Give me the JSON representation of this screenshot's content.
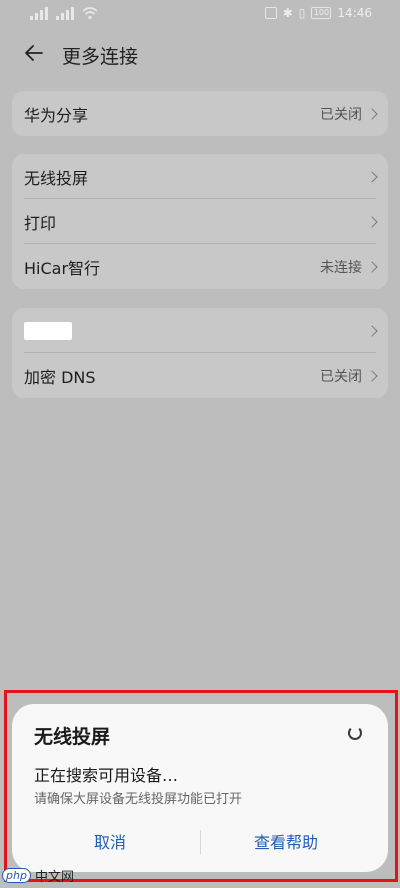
{
  "status_bar": {
    "time": "14:46",
    "battery": "100"
  },
  "header": {
    "title": "更多连接"
  },
  "card1": {
    "items": [
      {
        "label": "华为分享",
        "value": "已关闭"
      }
    ]
  },
  "card2": {
    "items": [
      {
        "label": "无线投屏",
        "value": ""
      },
      {
        "label": "打印",
        "value": ""
      },
      {
        "label": "HiCar智行",
        "value": "未连接"
      }
    ]
  },
  "card3": {
    "items": [
      {
        "label": "",
        "value": ""
      },
      {
        "label": "加密 DNS",
        "value": "已关闭"
      }
    ]
  },
  "dialog": {
    "title": "无线投屏",
    "status": "正在搜索可用设备…",
    "hint": "请确保大屏设备无线投屏功能已打开",
    "cancel": "取消",
    "help": "查看帮助"
  },
  "watermark": {
    "logo": "php",
    "site": "中文网"
  },
  "colors": {
    "highlight": "#e3121c",
    "accent": "#1f5db8"
  }
}
